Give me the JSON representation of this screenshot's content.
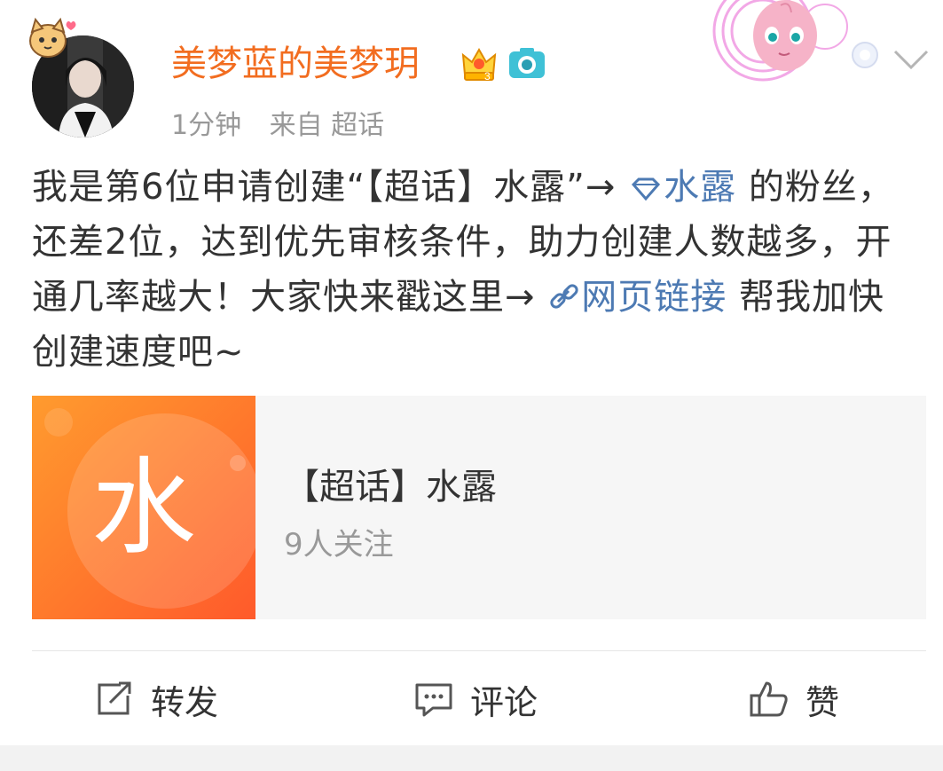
{
  "post": {
    "username": "美梦蓝的美梦玥",
    "time": "1分钟",
    "source": "来自 超话",
    "content": {
      "line1_a": "我是第6位申请创建“【超话】水露”→ ",
      "topic_link": "水露",
      "line1_b": " 的粉丝，还差2位，达到优先审核条件，助力创建人数越多，开通几率越大！大家快来戳这里→ ",
      "web_link": "网页链接",
      "line_end": " 帮我加快创建速度吧~"
    }
  },
  "card": {
    "thumb_glyph": "水",
    "title": "【超话】水露",
    "subtitle": "9人关注"
  },
  "actions": {
    "repost": "转发",
    "comment": "评论",
    "like": "赞"
  },
  "colors": {
    "username": "#f26d20",
    "link": "#4d7ab3",
    "card_gradient_start": "#ff9b2e",
    "card_gradient_end": "#ff5a2b"
  }
}
